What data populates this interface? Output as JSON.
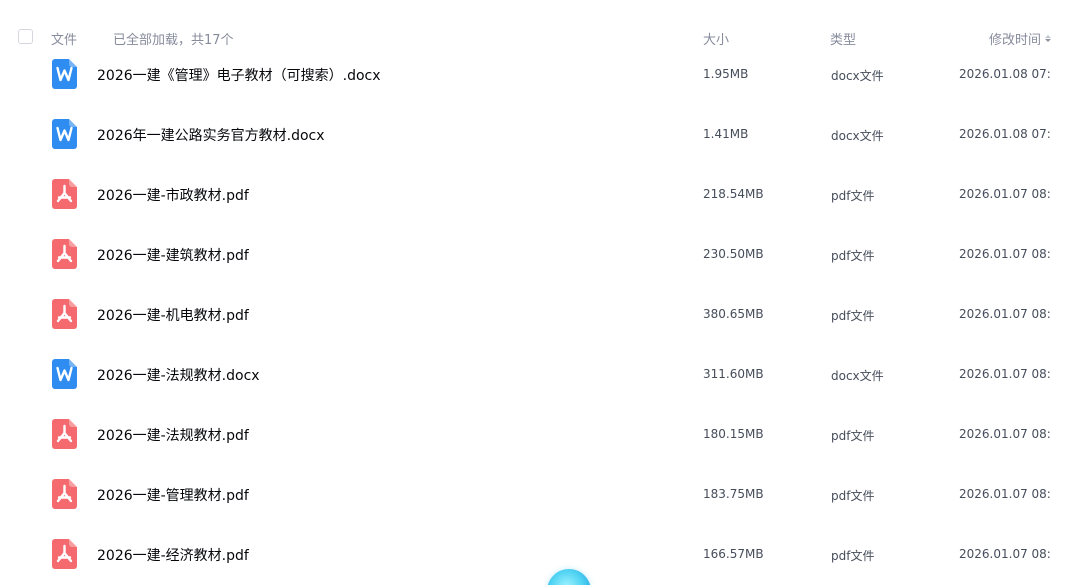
{
  "header": {
    "file_label": "文件",
    "loaded_label": "已全部加载，共17个",
    "size_label": "大小",
    "type_label": "类型",
    "mtime_label": "修改时间"
  },
  "files": [
    {
      "name": "2026一建《管理》电子教材（可搜索）.docx",
      "size": "1.95MB",
      "type": "docx文件",
      "mtime": "2026.01.08 07:...",
      "icon": "word-doc-icon"
    },
    {
      "name": "2026年一建公路实务官方教材.docx",
      "size": "1.41MB",
      "type": "docx文件",
      "mtime": "2026.01.08 07:...",
      "icon": "word-doc-icon"
    },
    {
      "name": "2026一建-市政教材.pdf",
      "size": "218.54MB",
      "type": "pdf文件",
      "mtime": "2026.01.07 08:...",
      "icon": "pdf-icon"
    },
    {
      "name": "2026一建-建筑教材.pdf",
      "size": "230.50MB",
      "type": "pdf文件",
      "mtime": "2026.01.07 08:...",
      "icon": "pdf-icon"
    },
    {
      "name": "2026一建-机电教材.pdf",
      "size": "380.65MB",
      "type": "pdf文件",
      "mtime": "2026.01.07 08:...",
      "icon": "pdf-icon"
    },
    {
      "name": "2026一建-法规教材.docx",
      "size": "311.60MB",
      "type": "docx文件",
      "mtime": "2026.01.07 08:...",
      "icon": "word-doc-icon"
    },
    {
      "name": "2026一建-法规教材.pdf",
      "size": "180.15MB",
      "type": "pdf文件",
      "mtime": "2026.01.07 08:...",
      "icon": "pdf-icon"
    },
    {
      "name": "2026一建-管理教材.pdf",
      "size": "183.75MB",
      "type": "pdf文件",
      "mtime": "2026.01.07 08:...",
      "icon": "pdf-icon"
    },
    {
      "name": "2026一建-经济教材.pdf",
      "size": "166.57MB",
      "type": "pdf文件",
      "mtime": "2026.01.07 08:...",
      "icon": "pdf-icon"
    }
  ],
  "colors": {
    "word_icon": "#2f8cf0",
    "pdf_icon": "#f46a6f",
    "header_text": "#878c9c",
    "name_text": "#06070b"
  }
}
